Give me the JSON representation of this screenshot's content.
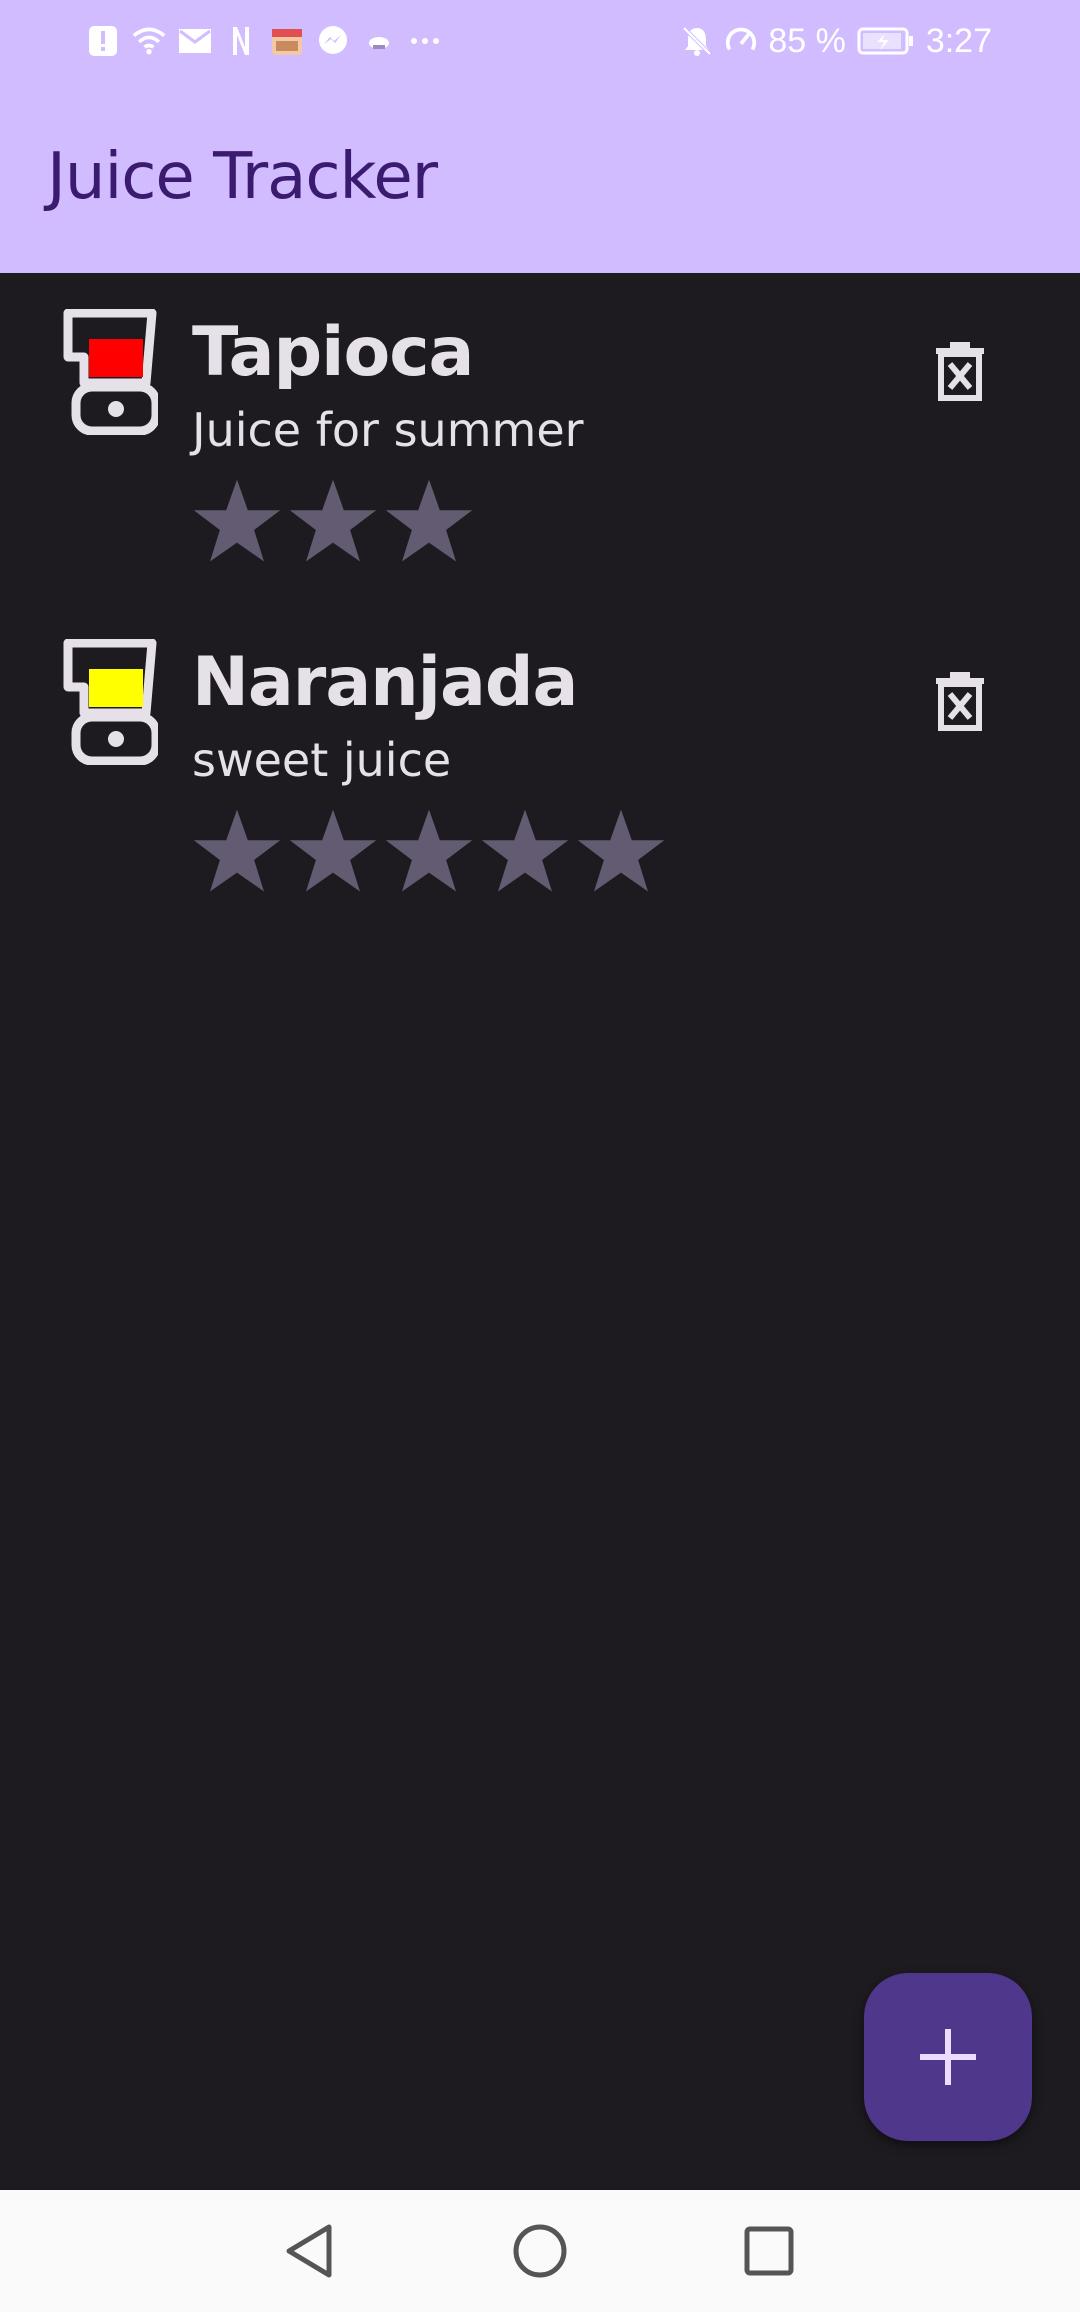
{
  "status_bar": {
    "left_icons": [
      "alert-icon",
      "wifi-icon",
      "mail-icon",
      "netflix-icon",
      "app-icon",
      "messenger-icon",
      "cloud-icon",
      "more-dots-icon"
    ],
    "battery_percent": "85 %",
    "time": "3:27"
  },
  "app_bar": {
    "title": "Juice Tracker"
  },
  "juices": [
    {
      "name": "Tapioca",
      "description": "Juice for summer",
      "rating": 3,
      "color": "#ff0000"
    },
    {
      "name": "Naranjada",
      "description": "sweet juice",
      "rating": 5,
      "color": "#ffff00"
    }
  ],
  "colors": {
    "app_bar": "#d0bcff",
    "background": "#1d1b20",
    "fab": "#4f378b",
    "star": "#625b71"
  },
  "fab": {
    "icon": "plus-icon"
  },
  "nav": {
    "icons": [
      "back-icon",
      "home-icon",
      "recents-icon"
    ]
  }
}
